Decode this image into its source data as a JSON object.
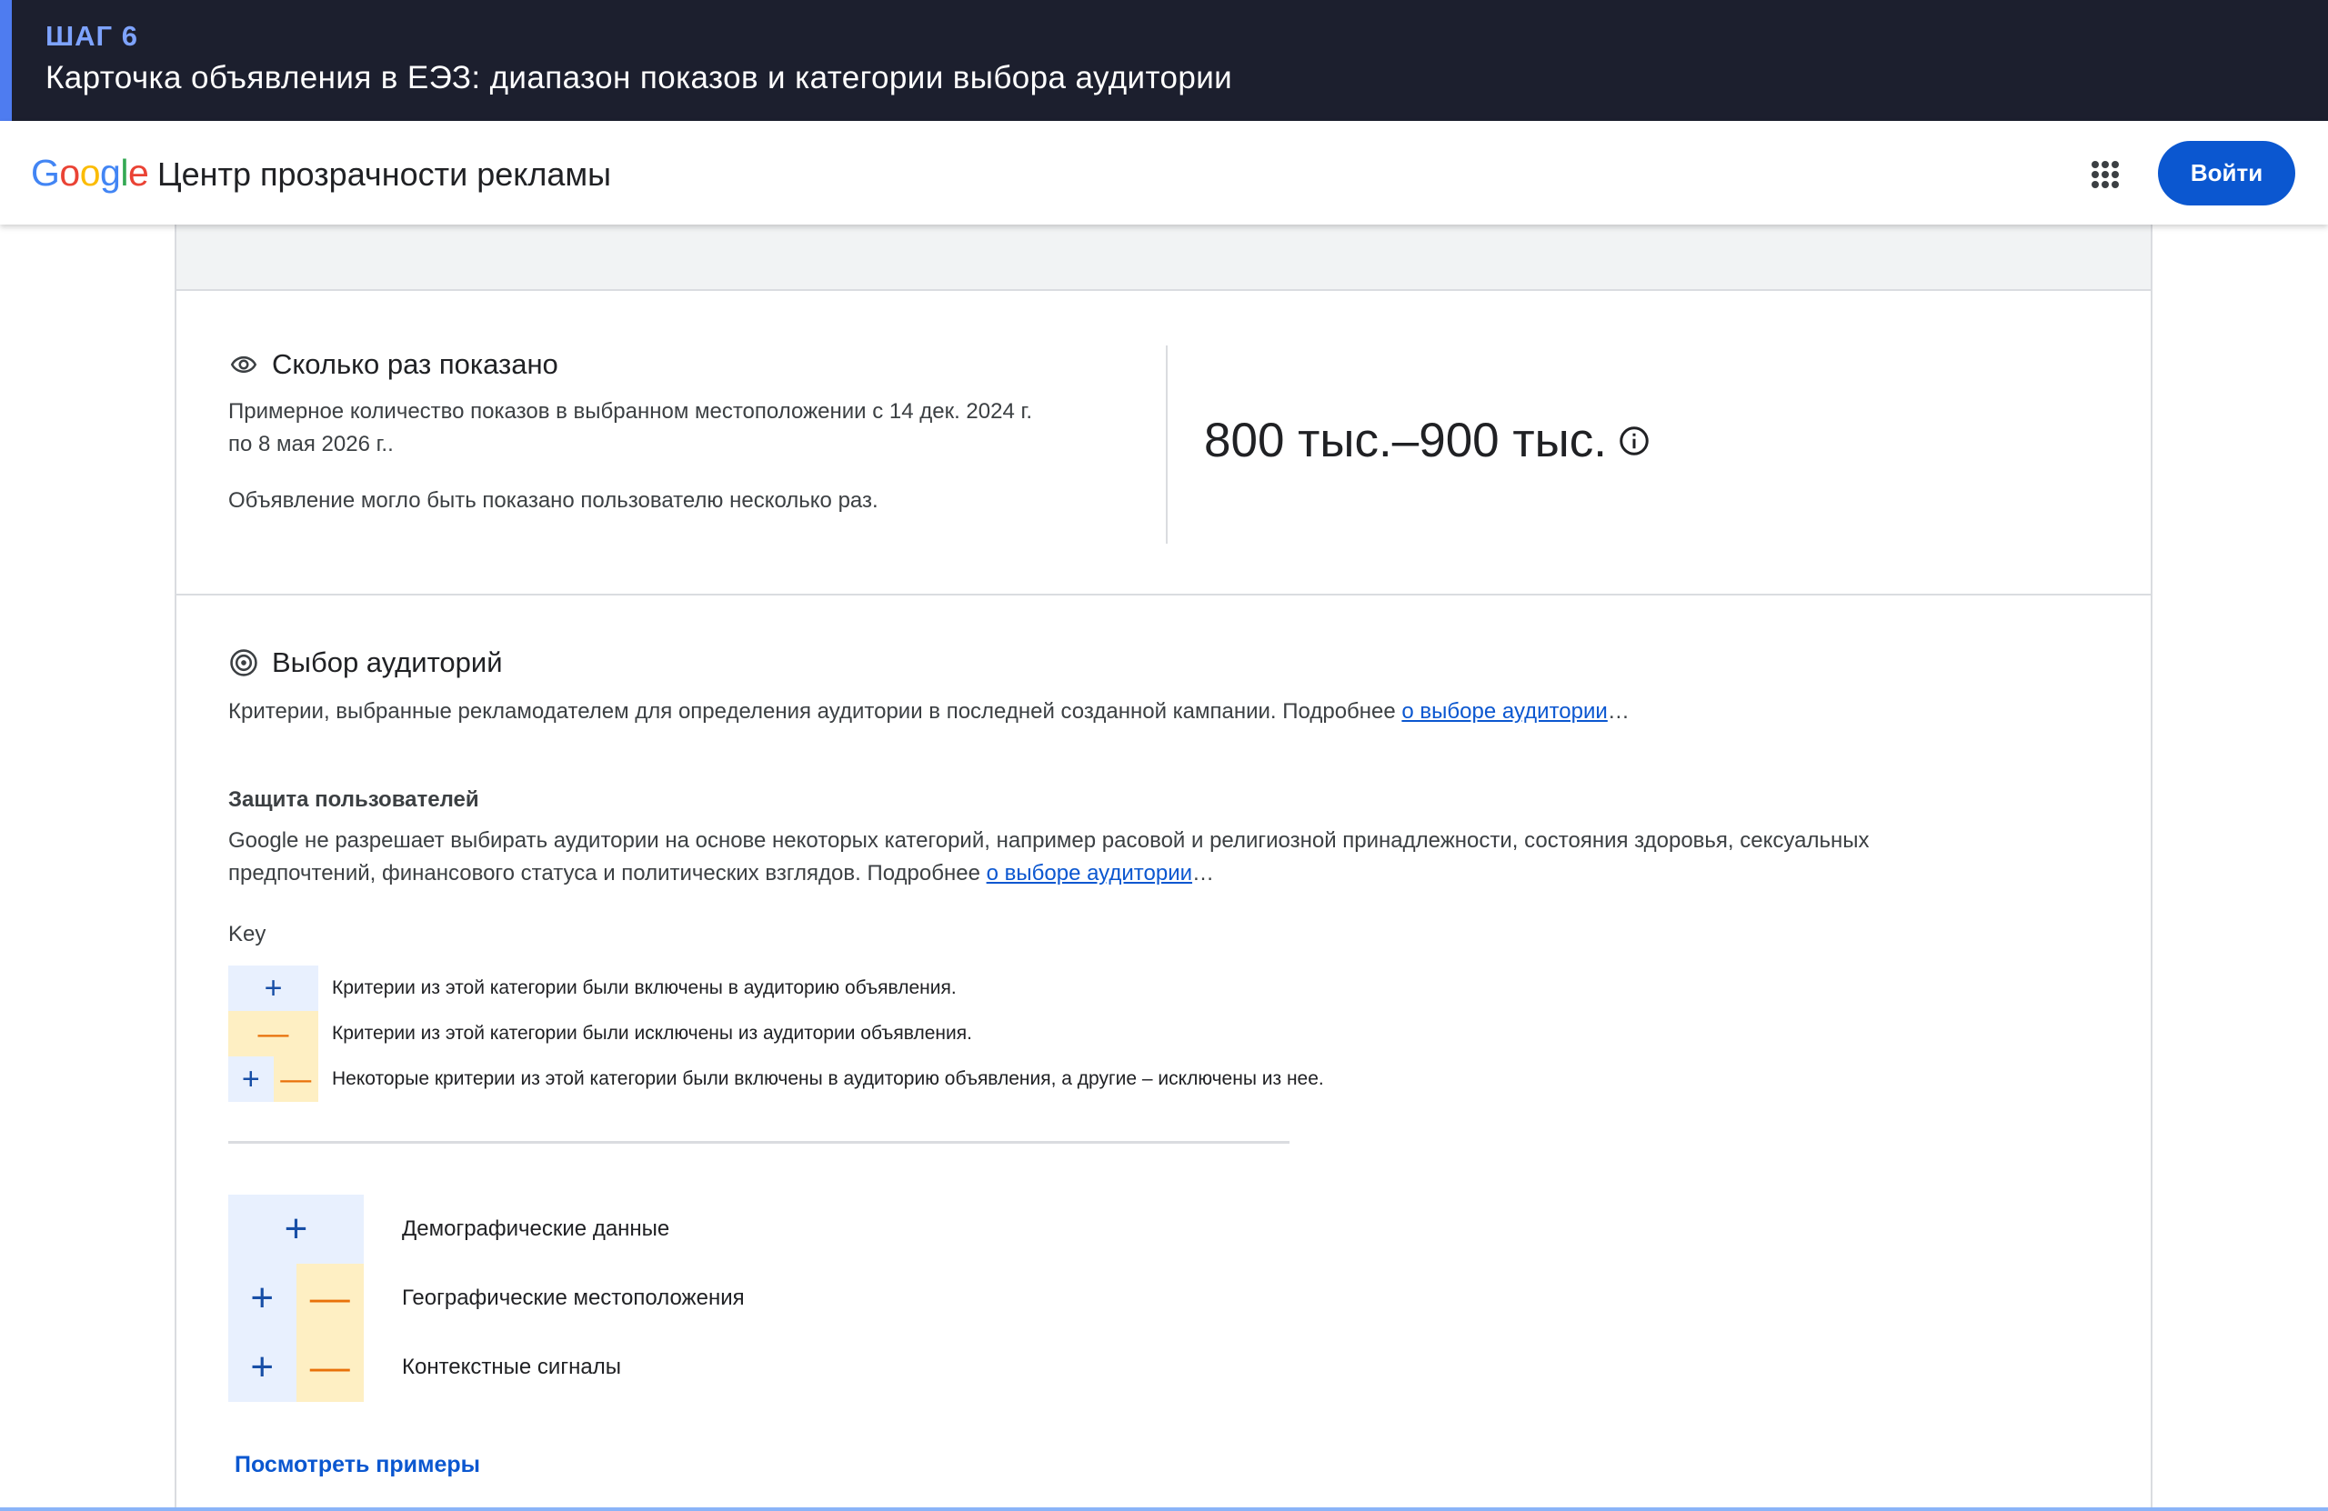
{
  "step": {
    "number": "ШАГ 6",
    "title": "Карточка объявления в ЕЭЗ: диапазон показов и категории выбора аудитории"
  },
  "header": {
    "logo_letters": [
      "G",
      "o",
      "o",
      "g",
      "l",
      "e"
    ],
    "title": "Центр прозрачности рекламы",
    "apps_icon": "apps-grid-icon",
    "signin_label": "Войти"
  },
  "impressions": {
    "icon": "eye-icon",
    "heading": "Сколько раз показано",
    "desc_line1": "Примерное количество показов в выбранном местоположении с 14 дек. 2024 г.",
    "desc_line2": "по 8 мая 2026 г..",
    "note": "Объявление могло быть показано пользователю несколько раз.",
    "range": "800 тыс.–900 тыс.",
    "info_icon": "info-icon"
  },
  "audience": {
    "icon": "target-icon",
    "heading": "Выбор аудиторий",
    "desc_text": "Критерии, выбранные рекламодателем для определения аудитории в последней созданной кампании. Подробнее ",
    "desc_link": "о выборе аудитории",
    "desc_ellipsis": "…",
    "protection_heading": "Защита пользователей",
    "protection_line1": "Google не разрешает выбирать аудитории на основе некоторых категорий, например расовой и религиозной принадлежности, состояния здоровья, сексуальных",
    "protection_line2": "предпочтений, финансового статуса и политических взглядов. Подробнее ",
    "protection_link": "о выборе аудитории",
    "protection_ellipsis": "…",
    "key_label": "Key",
    "key_items": [
      {
        "symbols": "+",
        "text": "Критерии из этой категории были включены в аудиторию объявления."
      },
      {
        "symbols": "–",
        "text": "Критерии из этой категории были исключены из аудитории объявления."
      },
      {
        "symbols": "+ –",
        "text": "Некоторые критерии из этой категории были включены в аудиторию объявления, а другие – исключены из нее."
      }
    ],
    "plus_symbol": "+",
    "minus_symbol": "—",
    "categories": [
      {
        "label": "Демографические данные",
        "mode": "included"
      },
      {
        "label": "Географические местоположения",
        "mode": "mixed"
      },
      {
        "label": "Контекстные сигналы",
        "mode": "mixed"
      }
    ],
    "examples_link": "Посмотреть примеры"
  },
  "colors": {
    "banner_bg": "#1c1f2e",
    "banner_accent": "#4e7cf0",
    "primary_button": "#0b57d0",
    "include_bg": "#e8f0fe",
    "exclude_bg": "#feefc3",
    "include_fg": "#174ea6",
    "exclude_fg": "#e8710a"
  }
}
